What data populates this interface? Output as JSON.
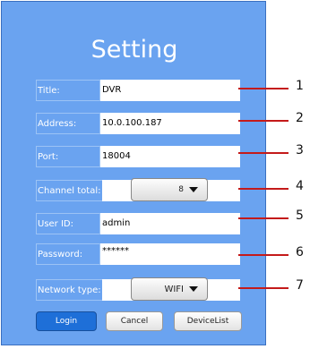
{
  "panel": {
    "title": "Setting",
    "fields": {
      "title": {
        "label": "Title:",
        "value": "DVR"
      },
      "address": {
        "label": "Address:",
        "value": "10.0.100.187"
      },
      "port": {
        "label": "Port:",
        "value": "18004"
      },
      "channel_total": {
        "label": "Channel total:",
        "value": "8"
      },
      "user_id": {
        "label": "User ID:",
        "value": "admin"
      },
      "password": {
        "label": "Password:",
        "value": "******"
      },
      "network_type": {
        "label": "Network type:",
        "value": "WIFI"
      }
    },
    "buttons": {
      "login": "Login",
      "cancel": "Cancel",
      "device_list": "DeviceList"
    }
  },
  "callouts": [
    "1",
    "2",
    "3",
    "4",
    "5",
    "6",
    "7"
  ],
  "colors": {
    "panel_bg": "#6aa3f0",
    "login_bg": "#1e6fd8",
    "callout_line": "#c41a1a"
  }
}
